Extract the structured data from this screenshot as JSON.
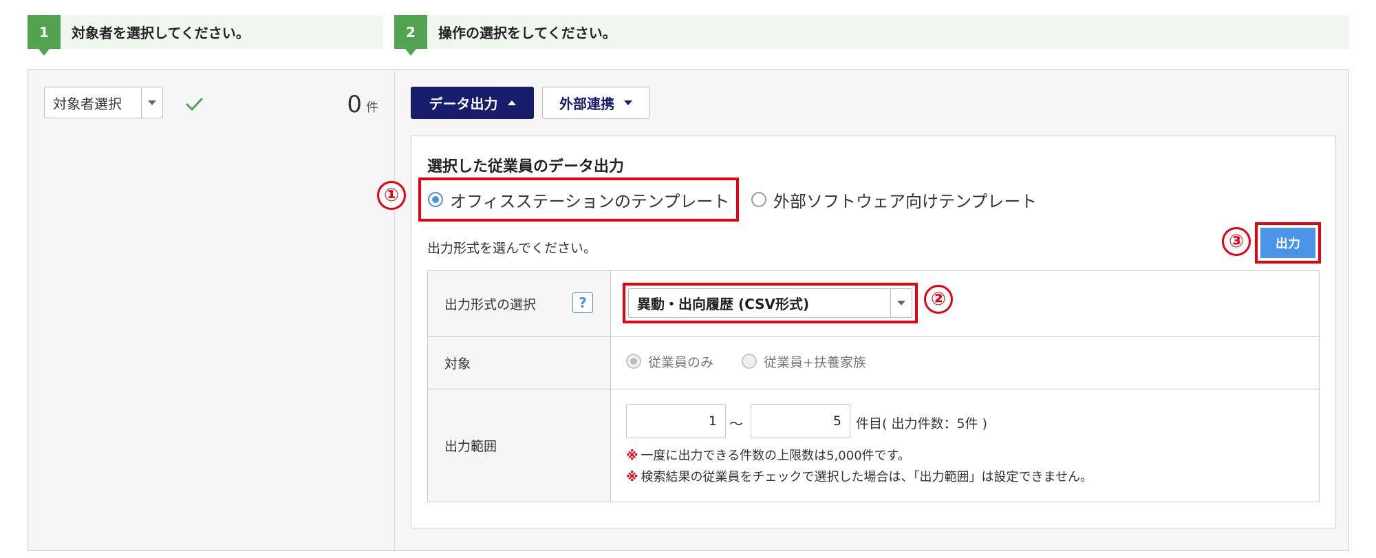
{
  "steps": [
    {
      "num": "1",
      "text": "対象者を選択してください。"
    },
    {
      "num": "2",
      "text": "操作の選択をしてください。"
    }
  ],
  "left": {
    "target_select_label": "対象者選択",
    "count_value": "0",
    "count_unit": "件"
  },
  "toolbar": {
    "data_output_label": "データ出力",
    "external_link_label": "外部連携"
  },
  "section": {
    "title": "選択した従業員のデータ出力",
    "template_options": [
      {
        "label": "オフィスステーションのテンプレート",
        "selected": true
      },
      {
        "label": "外部ソフトウェア向けテンプレート",
        "selected": false
      }
    ],
    "format_prompt": "出力形式を選んでください。",
    "output_button_label": "出力"
  },
  "form": {
    "format_row_label": "出力形式の選択",
    "help_icon_text": "?",
    "format_selected": "異動・出向履歴 (CSV形式)",
    "target_row_label": "対象",
    "target_options": [
      {
        "label": "従業員のみ",
        "selected": true
      },
      {
        "label": "従業員+扶養家族",
        "selected": false
      }
    ],
    "range_row_label": "出力範囲",
    "range_from": "1",
    "range_sep": "～",
    "range_to": "5",
    "range_suffix": "件目( 出力件数：5件 )",
    "note_mark": "※",
    "notes": [
      "一度に出力できる件数の上限数は5,000件です。",
      "検索結果の従業員をチェックで選択した場合は、「出力範囲」は設定できません。"
    ]
  },
  "annotations": [
    "①",
    "②",
    "③"
  ],
  "colors": {
    "step_green": "#53a451",
    "navy_button": "#171c6b",
    "output_blue": "#4a95e8",
    "annotation_red": "#e60012",
    "check_green": "#53a451"
  }
}
